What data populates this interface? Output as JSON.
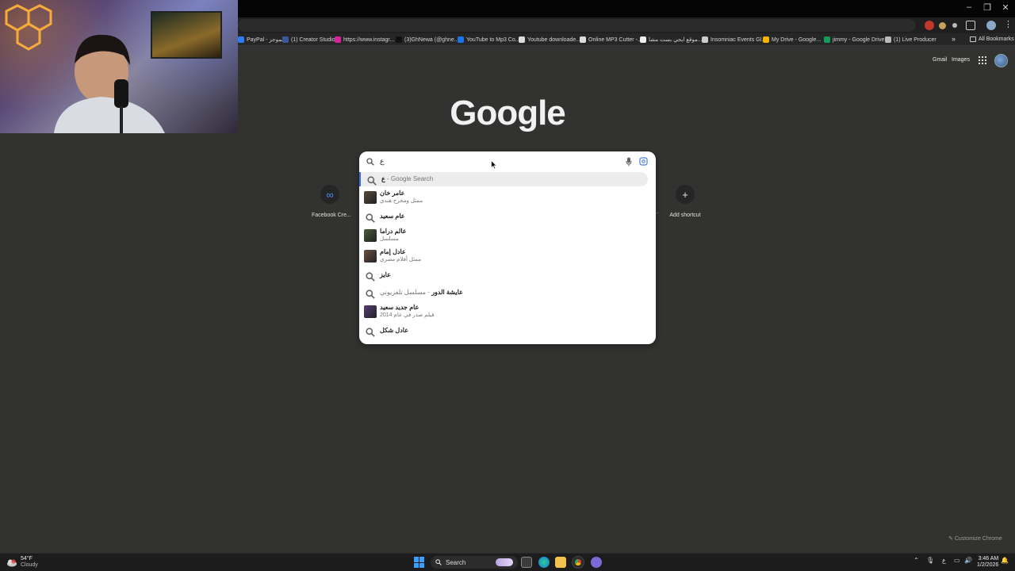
{
  "window": {
    "minimize": "–",
    "restore": "❐",
    "close": "✕"
  },
  "bookmarks": [
    {
      "label": "PayPal - الموجز",
      "color": "#2f7df4"
    },
    {
      "label": "(1) Creator Studio",
      "color": "#3b5998"
    },
    {
      "label": "https://www.instagr...",
      "color": "#d6249f"
    },
    {
      "label": "(3)GhNewa (@ghne...",
      "color": "#111111"
    },
    {
      "label": "YouTube to Mp3 Co...",
      "color": "#1a73e8"
    },
    {
      "label": "Youtube downloade...",
      "color": "#dddddd"
    },
    {
      "label": "Online MP3 Cutter -...",
      "color": "#dddddd"
    },
    {
      "label": "موقع ايجي بست مشا...",
      "color": "#eeeeee"
    },
    {
      "label": "Insomniac Events Gl...",
      "color": "#cccccc"
    },
    {
      "label": "My Drive - Google...",
      "color": "#f4b400"
    },
    {
      "label": "jimmy - Google Drive",
      "color": "#0f9d58"
    },
    {
      "label": "(1) Live Producer",
      "color": "#bbbbbb"
    }
  ],
  "bookmarks_more": "»",
  "all_bookmarks": "All Bookmarks",
  "header": {
    "gmail": "Gmail",
    "images": "Images"
  },
  "logo": "Google",
  "shortcuts": {
    "left": {
      "label": "Facebook Cre...",
      "icon": "meta-icon",
      "glyph": "∞"
    },
    "right_dots": "...",
    "add": {
      "label": "Add shortcut",
      "glyph": "+"
    }
  },
  "search": {
    "value": "ع",
    "suggestions": [
      {
        "type": "search",
        "title": "ع",
        "dim": " - Google Search",
        "highlighted": true
      },
      {
        "type": "entity",
        "title": "عامر خان",
        "sub": "ممثل ومخرج هندي",
        "thumb": "#5a4a3a"
      },
      {
        "type": "search",
        "title": "عام سعيد"
      },
      {
        "type": "entity",
        "title": "عالم دراما",
        "sub": "مسلسل",
        "thumb": "#4a5a3a"
      },
      {
        "type": "entity",
        "title": "عادل إمام",
        "sub": "ممثل أفلام مصري",
        "thumb": "#6a5040"
      },
      {
        "type": "search",
        "title": "عايز"
      },
      {
        "type": "search",
        "title": "عايشة الدور",
        "dim": " - مسلسل تلفزيوني"
      },
      {
        "type": "entity",
        "title": "عام جديد سعيد",
        "sub": "فيلم صدر في عام 2014",
        "thumb": "#5a3a7a"
      },
      {
        "type": "search",
        "title": "عادل شكل"
      }
    ]
  },
  "customize": "Customize Chrome",
  "taskbar": {
    "weather_temp": "54°F",
    "weather_desc": "Cloudy",
    "search_label": "Search",
    "lang": "ع",
    "time": "3:46 AM",
    "date": "1/2/2026"
  }
}
